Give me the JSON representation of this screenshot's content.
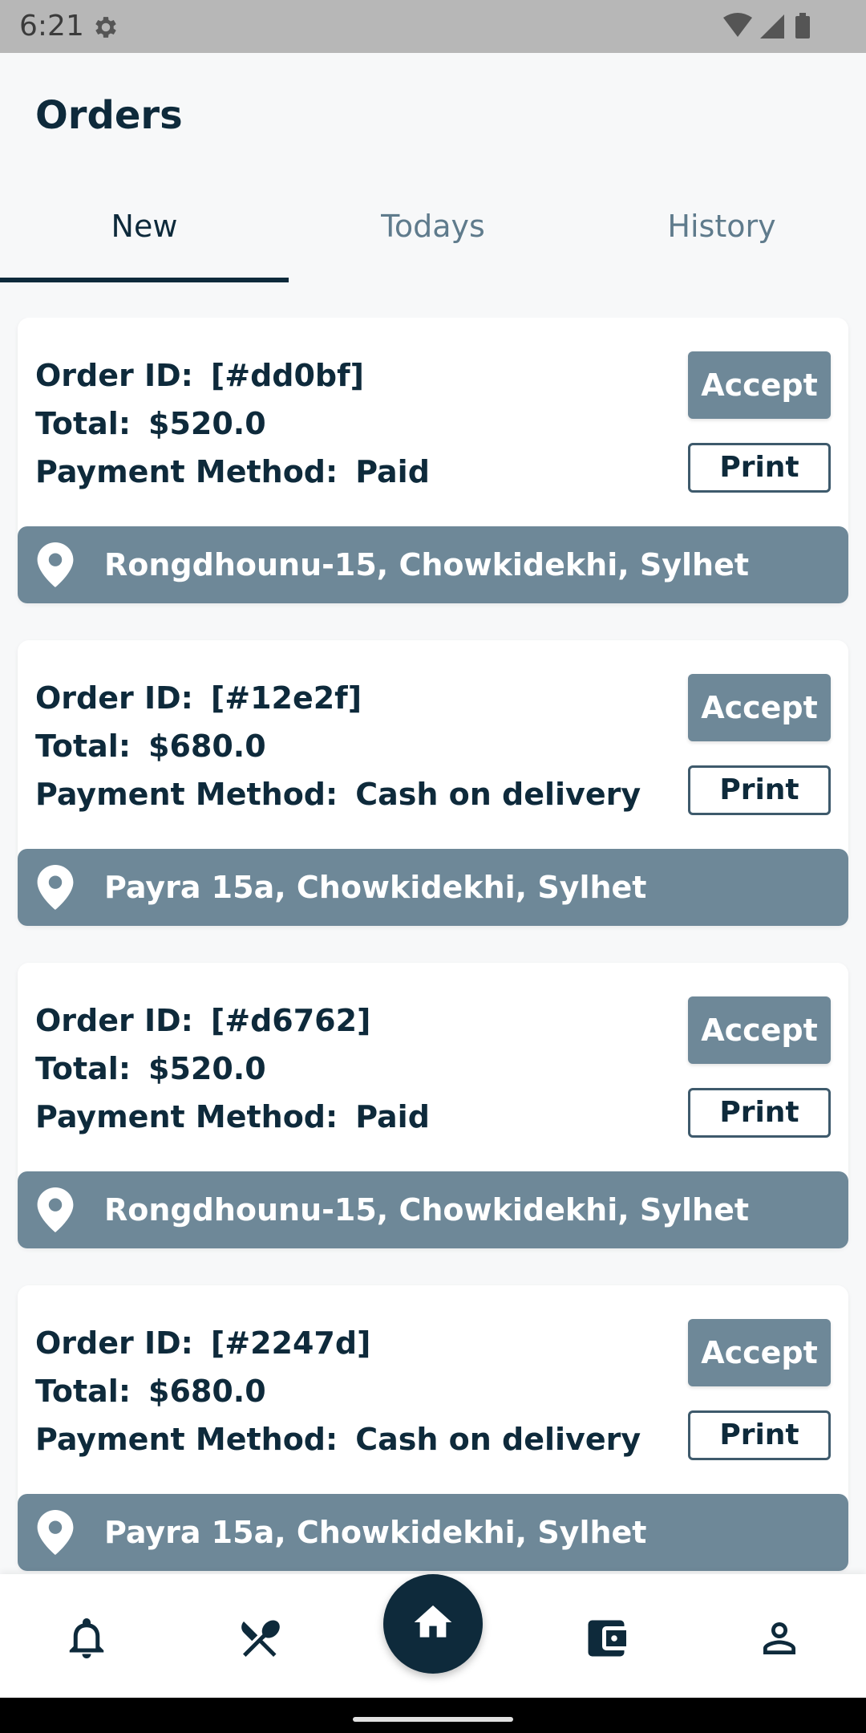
{
  "status_bar": {
    "time": "6:21"
  },
  "header": {
    "title": "Orders"
  },
  "tabs": [
    {
      "label": "New",
      "active": true
    },
    {
      "label": "Todays",
      "active": false
    },
    {
      "label": "History",
      "active": false
    }
  ],
  "labels": {
    "order_id": "Order ID:",
    "total": "Total:",
    "payment_method": "Payment Method:",
    "accept": "Accept",
    "print": "Print"
  },
  "orders": [
    {
      "id": "[#dd0bf]",
      "total": "$520.0",
      "payment": "Paid",
      "address": "Rongdhounu-15, Chowkidekhi, Sylhet"
    },
    {
      "id": "[#12e2f]",
      "total": "$680.0",
      "payment": "Cash on delivery",
      "address": "Payra 15a, Chowkidekhi, Sylhet"
    },
    {
      "id": "[#d6762]",
      "total": "$520.0",
      "payment": "Paid",
      "address": "Rongdhounu-15, Chowkidekhi, Sylhet"
    },
    {
      "id": "[#2247d]",
      "total": "$680.0",
      "payment": "Cash on delivery",
      "address": "Payra 15a, Chowkidekhi, Sylhet"
    }
  ],
  "bottom_nav": [
    {
      "icon": "bell-icon"
    },
    {
      "icon": "utensils-icon"
    },
    {
      "icon": "home-icon",
      "active": true
    },
    {
      "icon": "wallet-icon"
    },
    {
      "icon": "person-icon"
    }
  ],
  "colors": {
    "primary": "#0e2a3b",
    "accent": "#6e8898",
    "background": "#f7f8f9"
  }
}
